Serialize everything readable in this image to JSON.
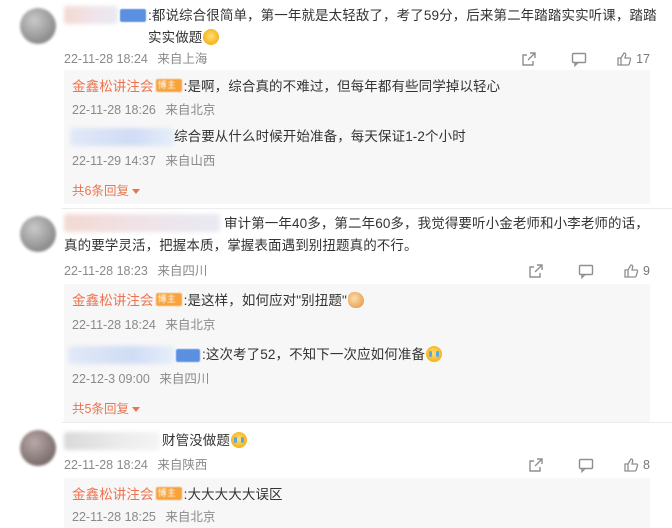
{
  "comments": [
    {
      "text": ":都说综合很简单，第一年就是太轻敌了，考了59分，后来第二年踏踏实实听课，踏踏实实做题",
      "date": "22-11-28 18:24",
      "location": "来自上海",
      "likes": "17",
      "replies": [
        {
          "author": "金鑫松讲注会",
          "text": ":是啊，综合真的不难过，但每年都有些同学掉以轻心",
          "date": "22-11-28 18:26",
          "location": "来自北京"
        },
        {
          "author": "",
          "text": "综合要从什么时候开始准备，每天保证1-2个小时",
          "date": "22-11-29 14:37",
          "location": "来自山西"
        }
      ],
      "more": "共6条回复"
    },
    {
      "text": "审计第一年40多，第二年60多，我觉得要听小金老师和小李老师的话，真的要学灵活，把握本质，掌握表面遇到别扭题真的不行。",
      "date": "22-11-28 18:23",
      "location": "来自四川",
      "likes": "9",
      "replies": [
        {
          "author": "金鑫松讲注会",
          "text": ":是这样，如何应对\"别扭题\"",
          "date": "22-11-28 18:24",
          "location": "来自北京"
        },
        {
          "author": "",
          "text": ":这次考了52，不知下一次应如何准备",
          "date": "22-12-3 09:00",
          "location": "来自四川"
        }
      ],
      "more": "共5条回复"
    },
    {
      "text": "财管没做题",
      "date": "22-11-28 18:24",
      "location": "来自陕西",
      "likes": "8",
      "replies": [
        {
          "author": "金鑫松讲注会",
          "text": ":大大大大大误区",
          "date": "22-11-28 18:25",
          "location": "来自北京"
        }
      ]
    }
  ],
  "icons": {
    "share": "share-icon",
    "comment": "comment-icon",
    "like": "thumbs-up-icon",
    "emoji_grin": "grin-emoji-icon",
    "emoji_muscle": "muscle-emoji-icon",
    "emoji_cry": "crying-laughing-emoji-icon"
  },
  "colors": {
    "blogger_name": "#eb7350",
    "meta_gray": "#8a8a8a",
    "reply_bg": "#f7f7f7",
    "link_orange": "#eb7350"
  }
}
